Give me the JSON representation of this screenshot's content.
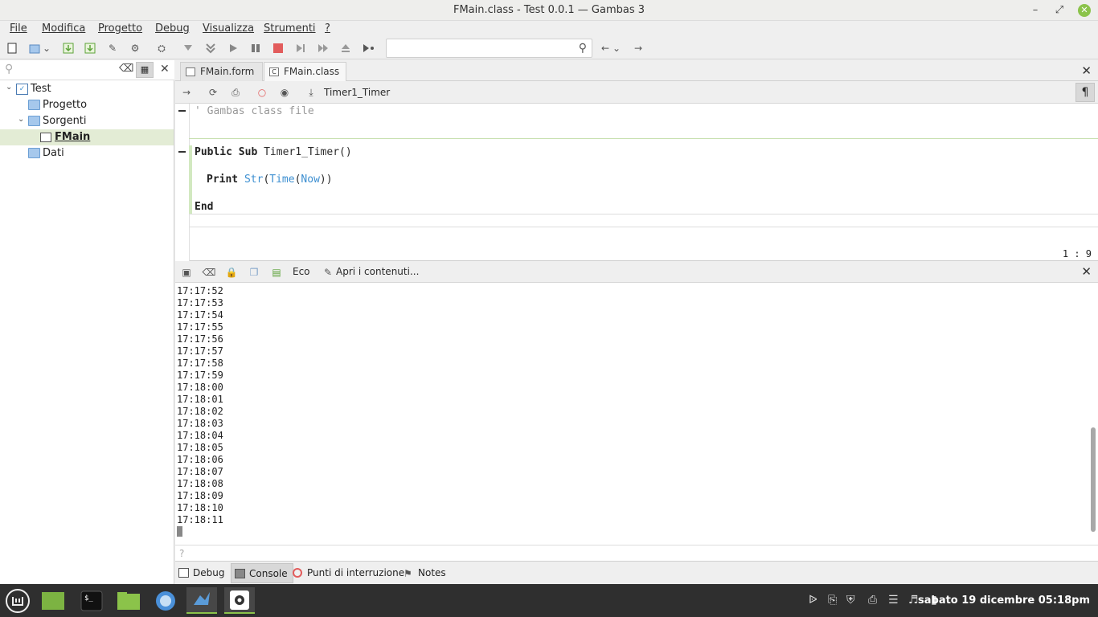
{
  "window": {
    "title": "FMain.class - Test 0.0.1 — Gambas 3",
    "minimize_icon": "minimize-icon",
    "maximize_icon": "maximize-icon",
    "close_icon": "close-icon"
  },
  "menu": {
    "items": [
      "File",
      "Modifica",
      "Progetto",
      "Debug",
      "Visualizza",
      "Strumenti",
      "?"
    ]
  },
  "toolbar": {
    "search_value": ""
  },
  "project_tree": {
    "items": [
      {
        "label": "Test",
        "level": 0,
        "expanded": true
      },
      {
        "label": "Progetto",
        "level": 1
      },
      {
        "label": "Sorgenti",
        "level": 1,
        "expanded": true
      },
      {
        "label": "FMain",
        "level": 2,
        "selected": true
      },
      {
        "label": "Dati",
        "level": 1
      }
    ]
  },
  "editor": {
    "tabs": [
      {
        "label": "FMain.form",
        "active": false
      },
      {
        "label": "FMain.class",
        "active": true
      }
    ],
    "procedure_selector": "Timer1_Timer",
    "pilcrow": "¶",
    "code": {
      "comment": "' Gambas class file",
      "kw_public_sub": "Public Sub",
      "sub_name": " Timer1_Timer()",
      "kw_print": "Print",
      "fn_str": "Str",
      "fn_time": "Time",
      "fn_now": "Now",
      "paren_open": "(",
      "paren_close_two": "))",
      "kw_end": "End"
    },
    "cursor_position": "1 : 9"
  },
  "console": {
    "toolbar": {
      "echo_label": "Eco",
      "open_contents_label": "Apri i contenuti..."
    },
    "lines": [
      "17:17:52",
      "17:17:53",
      "17:17:54",
      "17:17:55",
      "17:17:56",
      "17:17:57",
      "17:17:58",
      "17:17:59",
      "17:18:00",
      "17:18:01",
      "17:18:02",
      "17:18:03",
      "17:18:04",
      "17:18:05",
      "17:18:06",
      "17:18:07",
      "17:18:08",
      "17:18:09",
      "17:18:10",
      "17:18:11"
    ],
    "input_placeholder": "?"
  },
  "bottom_tabs": [
    {
      "label": "Debug",
      "active": false
    },
    {
      "label": "Console",
      "active": true
    },
    {
      "label": "Punti di interruzione",
      "active": false
    },
    {
      "label": "Notes",
      "active": false
    }
  ],
  "taskbar": {
    "clock": "sabato 19 dicembre 05:18pm"
  },
  "colors": {
    "accent": "#8bc34a",
    "code_function": "#3d8fd1",
    "selection": "#e3ecd5",
    "taskbar": "#2f2f2f"
  }
}
